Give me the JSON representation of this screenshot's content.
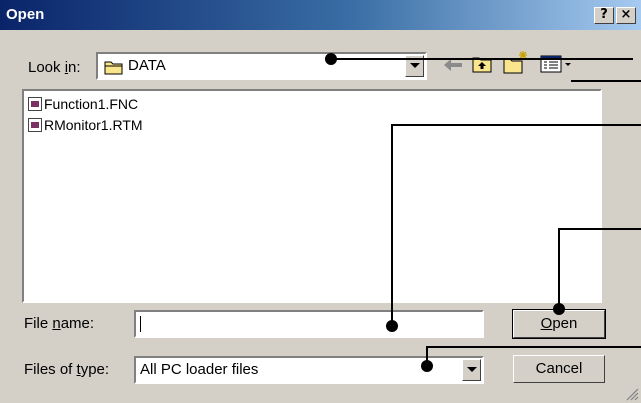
{
  "window": {
    "title": "Open"
  },
  "titlebar_buttons": {
    "help": "?",
    "close": "×"
  },
  "look_in": {
    "label_prefix": "Look ",
    "label_accel": "i",
    "label_suffix": "n:",
    "value": "DATA"
  },
  "toolbar": {
    "icons": [
      "back-icon",
      "up-folder-icon",
      "new-folder-icon",
      "view-menu-icon"
    ]
  },
  "files": [
    {
      "name": "Function1.FNC"
    },
    {
      "name": "RMonitor1.RTM"
    }
  ],
  "file_name": {
    "label_prefix": "File ",
    "label_accel": "n",
    "label_suffix": "ame:",
    "value": ""
  },
  "file_type": {
    "label_prefix": "Files of ",
    "label_accel": "t",
    "label_suffix": "ype:",
    "value": "All PC loader files"
  },
  "buttons": {
    "open_accel": "O",
    "open_rest": "pen",
    "cancel": "Cancel"
  },
  "colors": {
    "title_start": "#0a246a",
    "title_end": "#a6caf0",
    "face": "#d4d0c8"
  }
}
